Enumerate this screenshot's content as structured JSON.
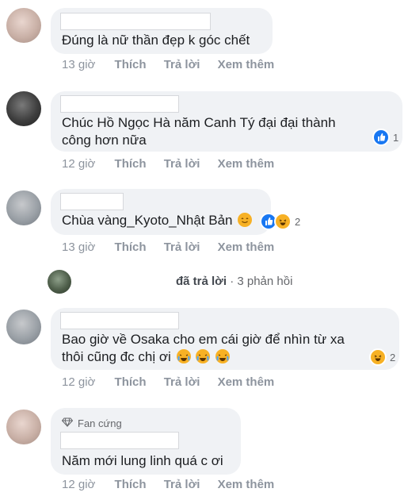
{
  "comments": [
    {
      "text": "Đúng là nữ thần đẹp k góc chết",
      "time": "13 giờ",
      "like": "Thích",
      "reply": "Trả lời",
      "more": "Xem thêm"
    },
    {
      "text_line1": "Chúc Hồ Ngọc Hà năm Canh Tý đại đại thành",
      "text_line2": "công hơn nữa",
      "reaction_count": "1",
      "time": "12 giờ",
      "like": "Thích",
      "reply": "Trả lời",
      "more": "Xem thêm"
    },
    {
      "text": "Chùa vàng_Kyoto_Nhật Bản",
      "reaction_count": "2",
      "time": "13 giờ",
      "like": "Thích",
      "reply": "Trả lời",
      "more": "Xem thêm"
    },
    {
      "text_line1": "Bao giờ về Osaka cho em cái giờ để nhìn từ xa",
      "text_line2": "thôi cũng đc chị ơi",
      "reaction_count": "2",
      "time": "12 giờ",
      "like": "Thích",
      "reply": "Trả lời",
      "more": "Xem thêm"
    },
    {
      "badge": "Fan cứng",
      "text": "Năm mới lung linh quá c ơi",
      "time": "12 giờ",
      "like": "Thích",
      "reply": "Trả lời",
      "more": "Xem thêm"
    }
  ],
  "replies": {
    "action": "đã trả lời",
    "separator": "·",
    "count": "3 phản hồi"
  },
  "colors": {
    "bubble": "#f0f2f5",
    "meta_text": "#8d949e",
    "like_blue": "#1877f2",
    "haha_yellow": "#f7b125"
  },
  "icons": [
    "like-reaction-icon",
    "haha-reaction-icon",
    "smile-emoji-icon",
    "crying-laughing-emoji-icon",
    "diamond-icon"
  ]
}
